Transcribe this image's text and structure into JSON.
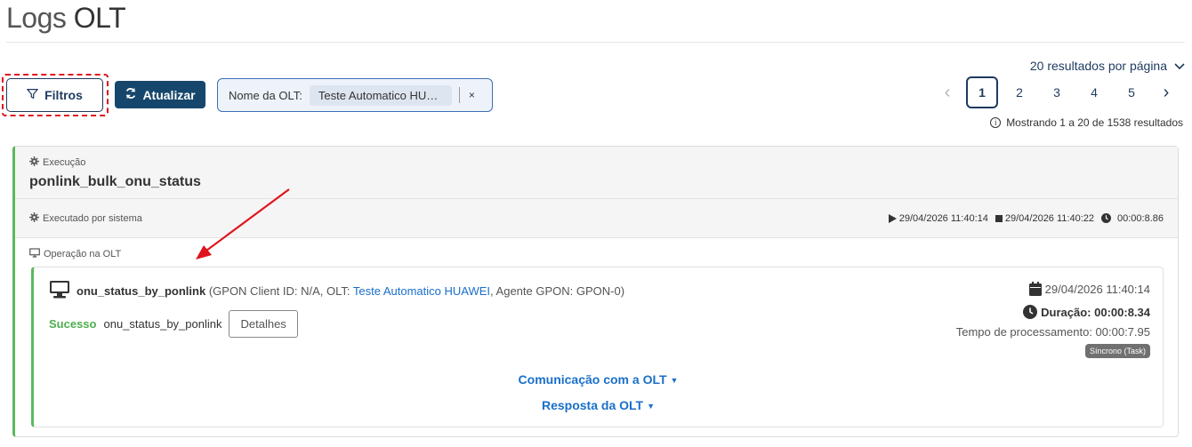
{
  "page": {
    "title_light": "Logs ",
    "title_bold": "OLT"
  },
  "toolbar": {
    "filters_label": "Filtros",
    "refresh_label": "Atualizar",
    "filter_chip": {
      "label": "Nome da OLT:",
      "value": "Teste Automatico HUAWEI",
      "close": "×"
    }
  },
  "pagination": {
    "per_page": "20 resultados por página",
    "prev": "‹",
    "next": "›",
    "pages": [
      "1",
      "2",
      "3",
      "4",
      "5"
    ],
    "active_page": "1",
    "showing": "Mostrando 1 a 20 de 1538 resultados"
  },
  "execution": {
    "section_label": "Execução",
    "name": "ponlink_bulk_onu_status",
    "executed_by": "Executado por sistema",
    "start": "29/04/2026 11:40:14",
    "end": "29/04/2026 11:40:22",
    "duration": "00:00:8.86",
    "operation_section_label": "Operação na OLT",
    "operation": {
      "name": "onu_status_by_ponlink",
      "desc_prefix": "(GPON Client ID: N/A, OLT: ",
      "olt_link": "Teste Automatico HUAWEI",
      "desc_suffix": ", Agente GPON: GPON-0)",
      "status": "Sucesso",
      "status_text": "onu_status_by_ponlink",
      "details_label": "Detalhes",
      "date": "29/04/2026 11:40:14",
      "duration": "Duração: 00:00:8.34",
      "processing": "Tempo de processamento: 00:00:7.95",
      "badge": "Síncrono (Task)",
      "comm_link": "Comunicação com a OLT",
      "response_link": "Resposta da OLT"
    }
  },
  "colors": {
    "primary": "#16466b",
    "success": "#5cb85c",
    "link": "#1a6fc9",
    "annotation": "#e0141e"
  }
}
